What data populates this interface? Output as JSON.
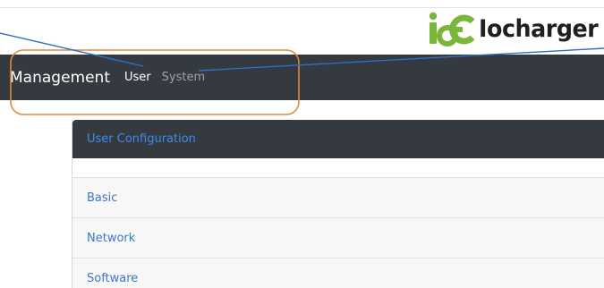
{
  "brand": {
    "name": "Iocharger"
  },
  "navbar": {
    "title": "Management",
    "links": [
      "User",
      "System"
    ],
    "active_link": "User"
  },
  "panel": {
    "header": "User Configuration",
    "items": [
      "Basic",
      "Network",
      "Software"
    ]
  },
  "colors": {
    "navbar_bg": "#343a40",
    "link_blue": "#3a78c9",
    "header_link_blue": "#3d8ce8",
    "muted_link": "#9ea3a8",
    "annotation_orange": "#e5883a",
    "annotation_blue": "#2f6fc9",
    "logo_green": "#79b63a"
  }
}
